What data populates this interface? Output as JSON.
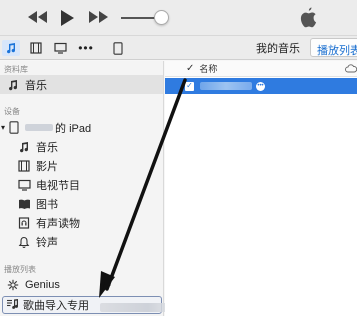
{
  "toolbar": {
    "more_label": "•••",
    "my_music_tab": "我的音乐",
    "playlist_tab": "播放列表"
  },
  "sidebar": {
    "library_header": "资料库",
    "library_items": [
      {
        "label": "音乐",
        "icon": "music-note-icon",
        "selected": true
      }
    ],
    "devices_header": "设备",
    "device": {
      "name_suffix": "的 iPad",
      "icon": "ipad-icon"
    },
    "device_items": [
      {
        "label": "音乐",
        "icon": "music-note-icon"
      },
      {
        "label": "影片",
        "icon": "film-icon"
      },
      {
        "label": "电视节目",
        "icon": "tv-icon"
      },
      {
        "label": "图书",
        "icon": "book-icon"
      },
      {
        "label": "有声读物",
        "icon": "audiobook-icon"
      },
      {
        "label": "铃声",
        "icon": "bell-icon"
      }
    ],
    "playlists_header": "播放列表",
    "playlists": [
      {
        "label": "Genius",
        "icon": "genius-icon"
      },
      {
        "label": "歌曲导入专用",
        "icon": "playlist-music-icon"
      }
    ]
  },
  "main": {
    "column_header": "名称",
    "selected_accent": "#2f7be0"
  },
  "colors": {
    "accent": "#1a73d9",
    "selection": "#2f7be0"
  }
}
